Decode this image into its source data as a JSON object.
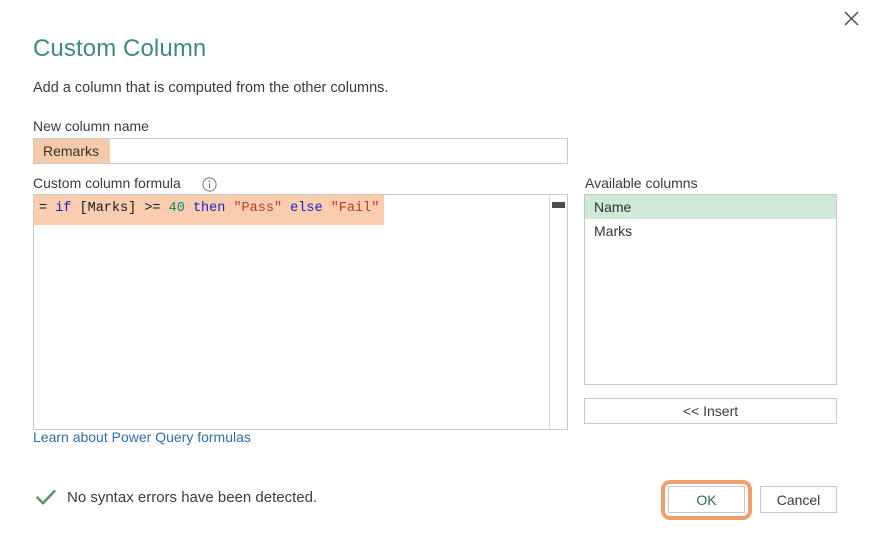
{
  "dialog": {
    "title": "Custom Column",
    "subtitle": "Add a column that is computed from the other columns.",
    "close_label": "×"
  },
  "new_column": {
    "label": "New column name",
    "value": "Remarks",
    "placeholder": "New column name"
  },
  "formula": {
    "label": "Custom column formula",
    "info_tooltip": "i",
    "text": "= if [Marks] >= 40 then \"Pass\" else \"Fail\"",
    "tokens": [
      {
        "t": "= ",
        "k": "pln"
      },
      {
        "t": "if",
        "k": "kw"
      },
      {
        "t": " [Marks] >= ",
        "k": "pln"
      },
      {
        "t": "40",
        "k": "num"
      },
      {
        "t": " ",
        "k": "pln"
      },
      {
        "t": "then",
        "k": "kw"
      },
      {
        "t": " ",
        "k": "pln"
      },
      {
        "t": "\"Pass\"",
        "k": "str"
      },
      {
        "t": " ",
        "k": "pln"
      },
      {
        "t": "else",
        "k": "kw"
      },
      {
        "t": " ",
        "k": "pln"
      },
      {
        "t": "\"Fail\"",
        "k": "str"
      }
    ],
    "learn_link": "Learn about Power Query formulas"
  },
  "available_columns": {
    "label": "Available columns",
    "items": [
      {
        "label": "Name",
        "selected": true
      },
      {
        "label": "Marks",
        "selected": false
      }
    ],
    "insert_label": "<< Insert"
  },
  "status": {
    "icon": "check-icon",
    "message": "No syntax errors have been detected."
  },
  "buttons": {
    "ok": "OK",
    "cancel": "Cancel"
  },
  "colors": {
    "title_green": "#3f8a7d",
    "highlight_salmon": "#f9cdae",
    "input_highlight": "#f6c9a8",
    "selection_green": "#cfe9d6",
    "annotation_orange": "#ef9e6d",
    "link_blue": "#2f6fa8",
    "check_green": "#5b9b6e",
    "keyword_blue": "#2020c8",
    "number_green": "#0f8a68",
    "string_red": "#c0392b"
  }
}
